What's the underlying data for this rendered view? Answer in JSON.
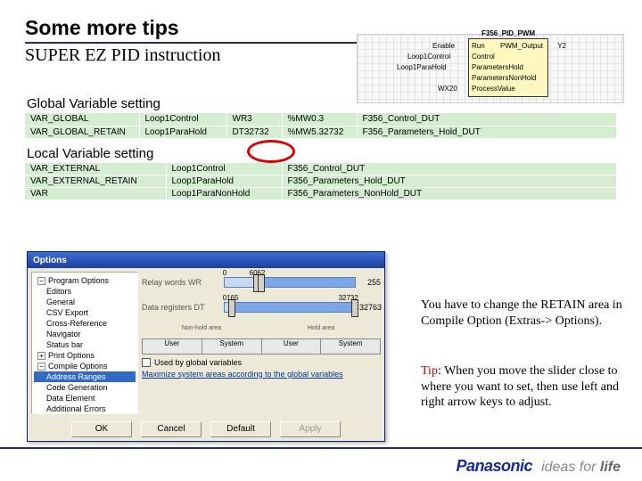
{
  "title": "Some more tips",
  "subtitle": "SUPER EZ PID instruction",
  "fb": {
    "head": "F356_PID_PWM",
    "left_lbl1": "Enable",
    "left_lbl2": "Loop1Control",
    "left_lbl3": "Loop1ParaHold",
    "left_lbl4": "WX20",
    "p_run": "Run",
    "p_control": "Control",
    "p_phold": "ParametersHold",
    "p_pnon": "ParametersNonHold",
    "p_pv": "ProcessValue",
    "p_out": "PWM_Output",
    "out_lbl": "Y2"
  },
  "sections": {
    "global": "Global Variable setting",
    "local": "Local Variable setting"
  },
  "gtable": {
    "r1": {
      "c1": "VAR_GLOBAL",
      "c2": "Loop1Control",
      "c3": "WR3",
      "c4": "%MW0.3",
      "c5": "F356_Control_DUT"
    },
    "r2": {
      "c1": "VAR_GLOBAL_RETAIN",
      "c2": "Loop1ParaHold",
      "c3": "DT32732",
      "c4": "%MW5.32732",
      "c5": "F356_Parameters_Hold_DUT"
    }
  },
  "ltable": {
    "r1": {
      "c1": "VAR_EXTERNAL",
      "c2": "Loop1Control",
      "c3": "F356_Control_DUT"
    },
    "r2": {
      "c1": "VAR_EXTERNAL_RETAIN",
      "c2": "Loop1ParaHold",
      "c3": "F356_Parameters_Hold_DUT"
    },
    "r3": {
      "c1": "VAR",
      "c2": "Loop1ParaNonHold",
      "c3": "F356_Parameters_NonHold_DUT"
    }
  },
  "dialog": {
    "title": "Options",
    "tree": {
      "n1": "Program Options",
      "n1a": "Editors",
      "n1b": "General",
      "n1c": "CSV Export",
      "n1d": "Cross-Reference",
      "n1e": "Navigator",
      "n1f": "Status bar",
      "n2": "Print Options",
      "n3": "Compile Options",
      "n3a": "Address Ranges",
      "n3b": "Code Generation",
      "n3c": "Data Element",
      "n3d": "Additional Errors"
    },
    "lbl_wr": "Relay words WR",
    "lbl_dt": "Data registers DT",
    "wr_min": "0",
    "wr_h1": "60",
    "wr_h2": "62",
    "wr_max": "255",
    "dt_min": "0",
    "dt_h1": "165",
    "dt_h2": "32732",
    "dt_max": "32763",
    "seg_top_l": "Non-hold area",
    "seg_top_r": "Hold area",
    "seg_user": "User",
    "seg_sys": "System",
    "chk": "Used by global variables",
    "link": "Maximize system areas according to the global variables",
    "ok": "OK",
    "cancel": "Cancel",
    "default": "Default",
    "apply": "Apply"
  },
  "note1": "You have to change the RETAIN area in Compile Option (Extras-> Options).",
  "note2a": "Tip",
  "note2b": ": When you move the slider close to where you want to set, then use left and right arrow keys to adjust.",
  "footer": {
    "brand": "Panasonic",
    "tag1": "ideas for ",
    "tag2": "life"
  }
}
